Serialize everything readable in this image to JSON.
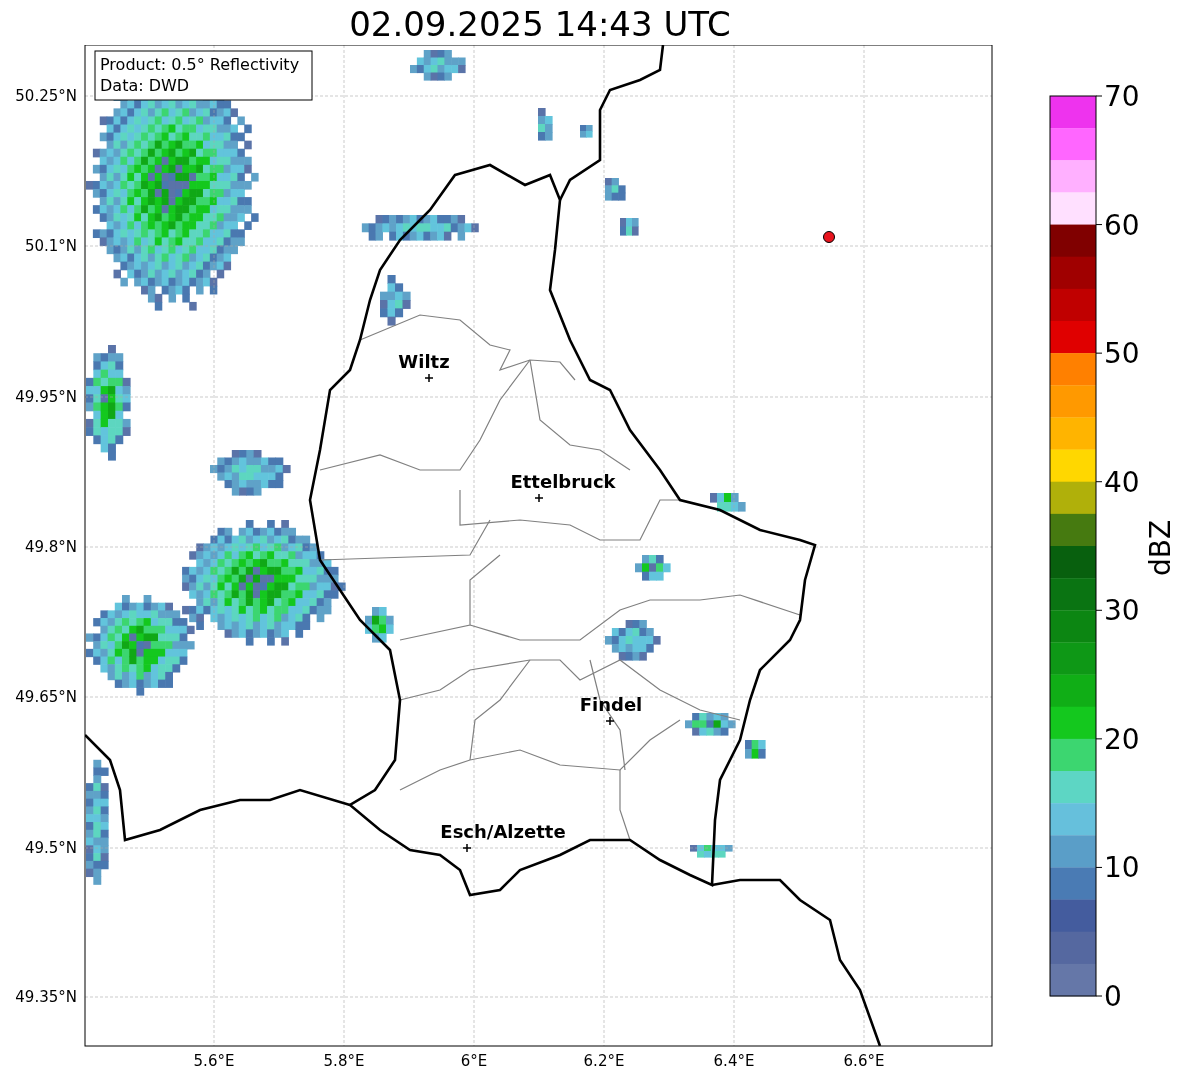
{
  "title": "02.09.2025 14:43 UTC",
  "info_box": [
    "Product: 0.5° Reflectivity",
    "Data: DWD"
  ],
  "lat_labels": [
    "50.25°N",
    "50.1°N",
    "49.95°N",
    "49.8°N",
    "49.65°N",
    "49.5°N",
    "49.35°N"
  ],
  "lon_labels": [
    "5.6°E",
    "5.8°E",
    "6°E",
    "6.2°E",
    "6.4°E",
    "6.6°E"
  ],
  "cities": [
    {
      "name": "Wiltz"
    },
    {
      "name": "Ettelbruck"
    },
    {
      "name": "Findel"
    },
    {
      "name": "Esch/Alzette"
    }
  ],
  "colorbar": {
    "label": "dBZ",
    "ticks": [
      "70",
      "60",
      "50",
      "40",
      "30",
      "20",
      "10",
      "0"
    ],
    "bins": [
      {
        "color": "#ee33ee"
      },
      {
        "color": "#ff66ff"
      },
      {
        "color": "#ffb0ff"
      },
      {
        "color": "#ffe0ff"
      },
      {
        "color": "#800000"
      },
      {
        "color": "#a00000"
      },
      {
        "color": "#c00000"
      },
      {
        "color": "#e00000"
      },
      {
        "color": "#ff8000"
      },
      {
        "color": "#ff9900"
      },
      {
        "color": "#ffb400"
      },
      {
        "color": "#ffd700"
      },
      {
        "color": "#b0b00a"
      },
      {
        "color": "#467a10"
      },
      {
        "color": "#08600e"
      },
      {
        "color": "#0a7412"
      },
      {
        "color": "#0c8612"
      },
      {
        "color": "#0e9816"
      },
      {
        "color": "#10ae16"
      },
      {
        "color": "#14c81e"
      },
      {
        "color": "#3cd670"
      },
      {
        "color": "#5dd6c4"
      },
      {
        "color": "#66c0dc"
      },
      {
        "color": "#5a9ec8"
      },
      {
        "color": "#4a7bb4"
      },
      {
        "color": "#445c9e"
      },
      {
        "color": "#5568a0"
      },
      {
        "color": "#6577a8"
      }
    ]
  }
}
